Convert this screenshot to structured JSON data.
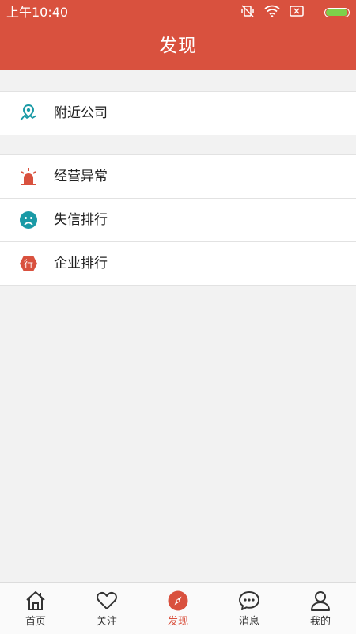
{
  "status_bar": {
    "time": "上午10:40",
    "battery_level": 1.0
  },
  "header": {
    "title": "发现"
  },
  "groups": [
    {
      "items": [
        {
          "label": "附近公司",
          "icon": "location-pin-icon"
        }
      ]
    },
    {
      "items": [
        {
          "label": "经营异常",
          "icon": "alarm-light-icon"
        },
        {
          "label": "失信排行",
          "icon": "sad-face-icon"
        },
        {
          "label": "企业排行",
          "icon": "hexagon-rank-icon",
          "icon_glyph": "行"
        }
      ]
    }
  ],
  "tabbar": {
    "tabs": [
      {
        "label": "首页",
        "icon": "home-icon",
        "active": false
      },
      {
        "label": "关注",
        "icon": "heart-icon",
        "active": false
      },
      {
        "label": "发现",
        "icon": "compass-icon",
        "active": true
      },
      {
        "label": "消息",
        "icon": "chat-bubble-icon",
        "active": false
      },
      {
        "label": "我的",
        "icon": "user-icon",
        "active": false
      }
    ]
  },
  "colors": {
    "brand": "#d9513e",
    "teal": "#1a9aa6",
    "background": "#f2f2f2",
    "battery": "#7ed04a"
  }
}
